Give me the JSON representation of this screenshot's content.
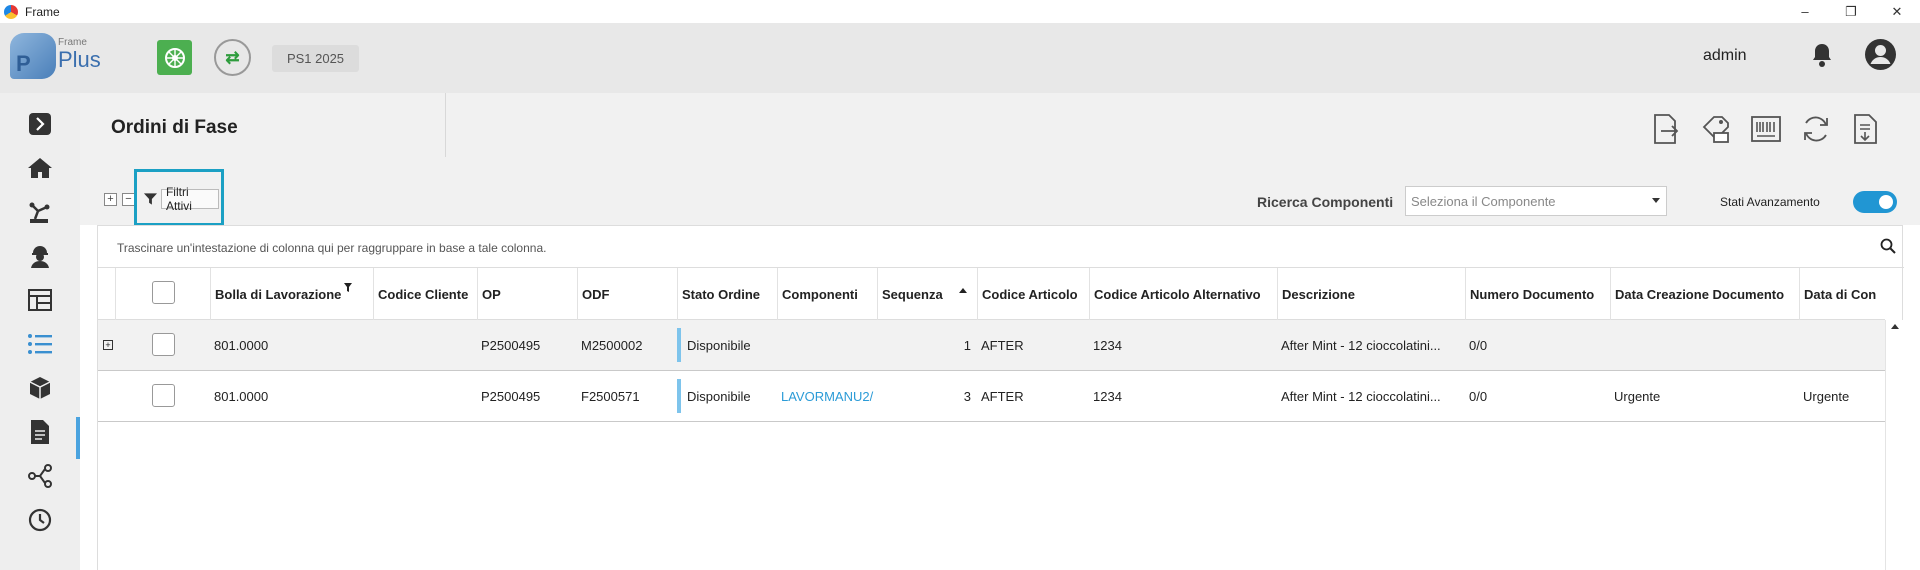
{
  "window": {
    "title": "Frame",
    "controls": [
      "–",
      "❐",
      "✕"
    ]
  },
  "header": {
    "logo_small": "Frame",
    "logo_big": "Plus",
    "logo_letter": "P",
    "environment": "PS1 2025",
    "user": "admin",
    "accent_green": "#4caf50"
  },
  "sidebar": {
    "items": [
      "expand-icon",
      "home-icon",
      "robot-arm-icon",
      "worker-icon",
      "dashboard-icon",
      "list-icon",
      "cube-icon",
      "document-icon",
      "workflow-icon",
      "clock-icon"
    ],
    "active_index": 5,
    "accent": "#4aa3df"
  },
  "page": {
    "title": "Ordini di Fase",
    "toolbar_icons": [
      "export-icon",
      "print-label-icon",
      "barcode-icon",
      "refresh-icon",
      "download-document-icon"
    ]
  },
  "filters": {
    "expand_all": "+",
    "collapse_all": "−",
    "active_filters_label": "Filtri Attivi",
    "search_components_label": "Ricerca Componenti",
    "component_placeholder": "Seleziona il Componente",
    "stati_label": "Stati Avanzamento",
    "stati_enabled": true
  },
  "grid": {
    "group_hint": "Trascinare un'intestazione di colonna qui per raggruppare in base a tale colonna.",
    "columns": [
      "Bolla di Lavorazione",
      "Codice Cliente",
      "OP",
      "ODF",
      "Stato Ordine",
      "Componenti",
      "Sequenza",
      "Codice Articolo",
      "Codice Articolo Alternativo",
      "Descrizione",
      "Numero Documento",
      "Data Creazione Documento",
      "Data di Con"
    ],
    "sorted_column": "Sequenza",
    "filtered_column": "Bolla di Lavorazione",
    "rows": [
      {
        "expand": "+",
        "bolla": "801.0000",
        "cliente": "",
        "op": "P2500495",
        "odf": "M2500002",
        "stato": "Disponibile",
        "componenti": "",
        "sequenza": "1",
        "codice": "AFTER",
        "codice_alt": "1234",
        "descrizione": "After Mint - 12 cioccolatini...",
        "numero_doc": "0/0",
        "data_creazione": "",
        "data_con": ""
      },
      {
        "expand": "",
        "bolla": "801.0000",
        "cliente": "",
        "op": "P2500495",
        "odf": "F2500571",
        "stato": "Disponibile",
        "componenti": "LAVORMANU2/",
        "sequenza": "3",
        "codice": "AFTER",
        "codice_alt": "1234",
        "descrizione": "After Mint - 12 cioccolatini...",
        "numero_doc": "0/0",
        "data_creazione": "Urgente",
        "data_con": "Urgente"
      }
    ]
  }
}
